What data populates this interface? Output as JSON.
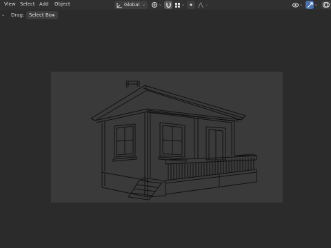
{
  "header": {
    "menu": [
      {
        "label": "View"
      },
      {
        "label": "Select"
      },
      {
        "label": "Add"
      },
      {
        "label": "Object"
      }
    ],
    "transform_orientation": "Global"
  },
  "toolbar": {
    "drag_label": "Drag:",
    "drag_value": "Select Box"
  },
  "icons": {
    "transform_orientation_icon": "axis-icon",
    "pivot_icon": "pivot-point-icon",
    "snap_icon": "snap-magnet-icon",
    "snap_target_icon": "snap-grid-icon",
    "proportional_icon": "proportional-edit-icon",
    "falloff_icon": "falloff-curve-icon",
    "visibility_icon": "eye-icon",
    "gizmo_icon": "gizmo-icon",
    "overlay_icon": "overlay-icon"
  },
  "colors": {
    "header_bg": "#303030",
    "viewport_bg": "#2b2b2b",
    "camera_frame_bg": "#3a3a3a",
    "accent": "#4772b3",
    "wire": "#111111"
  }
}
